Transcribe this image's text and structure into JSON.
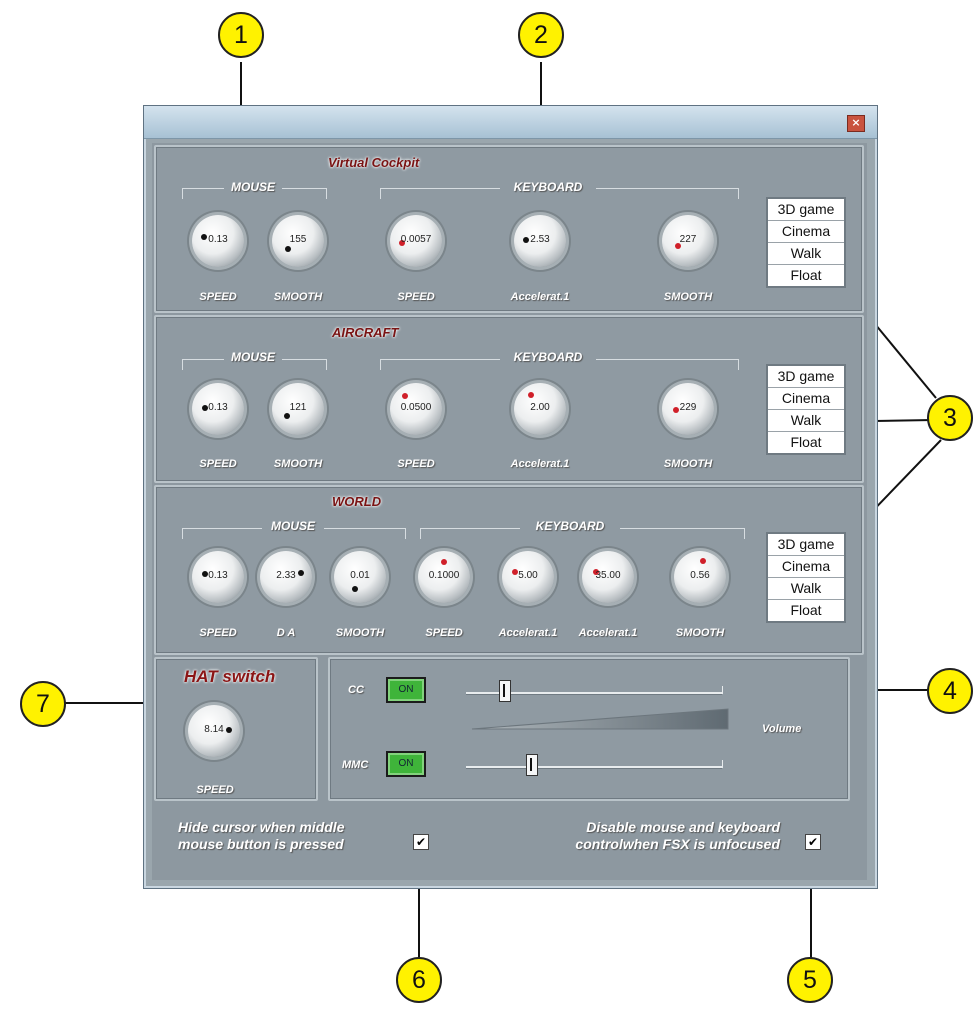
{
  "window": {
    "close_glyph": "×"
  },
  "virtual_cockpit": {
    "title": "Virtual Cockpit",
    "mouse_label": "MOUSE",
    "keyboard_label": "KEYBOARD",
    "mouse": [
      {
        "value": "0.13",
        "label": "SPEED"
      },
      {
        "value": "155",
        "label": "SMOOTH"
      }
    ],
    "keyboard": [
      {
        "value": "0.0057",
        "label": "SPEED"
      },
      {
        "value": "2.53",
        "label": "Accelerat.1"
      },
      {
        "value": "227",
        "label": "SMOOTH"
      }
    ],
    "modes": [
      "3D game",
      "Cinema",
      "Walk",
      "Float"
    ]
  },
  "aircraft": {
    "title": "AIRCRAFT",
    "mouse_label": "MOUSE",
    "keyboard_label": "KEYBOARD",
    "mouse": [
      {
        "value": "0.13",
        "label": "SPEED"
      },
      {
        "value": "121",
        "label": "SMOOTH"
      }
    ],
    "keyboard": [
      {
        "value": "0.0500",
        "label": "SPEED"
      },
      {
        "value": "2.00",
        "label": "Accelerat.1"
      },
      {
        "value": "229",
        "label": "SMOOTH"
      }
    ],
    "modes": [
      "3D game",
      "Cinema",
      "Walk",
      "Float"
    ]
  },
  "world": {
    "title": "WORLD",
    "mouse_label": "MOUSE",
    "keyboard_label": "KEYBOARD",
    "mouse": [
      {
        "value": "0.13",
        "label": "SPEED"
      },
      {
        "value": "2.33",
        "label": "D A"
      },
      {
        "value": "0.01",
        "label": "SMOOTH"
      }
    ],
    "keyboard": [
      {
        "value": "0.1000",
        "label": "SPEED"
      },
      {
        "value": "5.00",
        "label": "Accelerat.1"
      },
      {
        "value": "35.00",
        "label": "Accelerat.1"
      },
      {
        "value": "0.56",
        "label": "SMOOTH"
      }
    ],
    "modes": [
      "3D game",
      "Cinema",
      "Walk",
      "Float"
    ]
  },
  "hat": {
    "title": "HAT switch",
    "knob": {
      "value": "8.14",
      "label": "SPEED"
    }
  },
  "midi": {
    "cc_label": "CC",
    "mmc_label": "MMC",
    "cc_button": "ON",
    "mmc_button": "ON",
    "cc_slider_level": 0.14,
    "mmc_slider_level": 0.25,
    "volume_label": "Volume",
    "on_color": "#3fb43a"
  },
  "options": {
    "hide_cursor_line1": "Hide cursor when middle",
    "hide_cursor_line2": "mouse button is pressed",
    "hide_cursor_checked": "✔",
    "disable_line1": "Disable mouse and keyboard",
    "disable_line2": "controlwhen FSX is unfocused",
    "disable_checked": "✔"
  },
  "callouts": [
    "1",
    "2",
    "3",
    "4",
    "5",
    "6",
    "7"
  ],
  "colors": {
    "title_red": "#7a1414",
    "callout_yellow": "#fff200",
    "panel": "#8f9aa2"
  }
}
